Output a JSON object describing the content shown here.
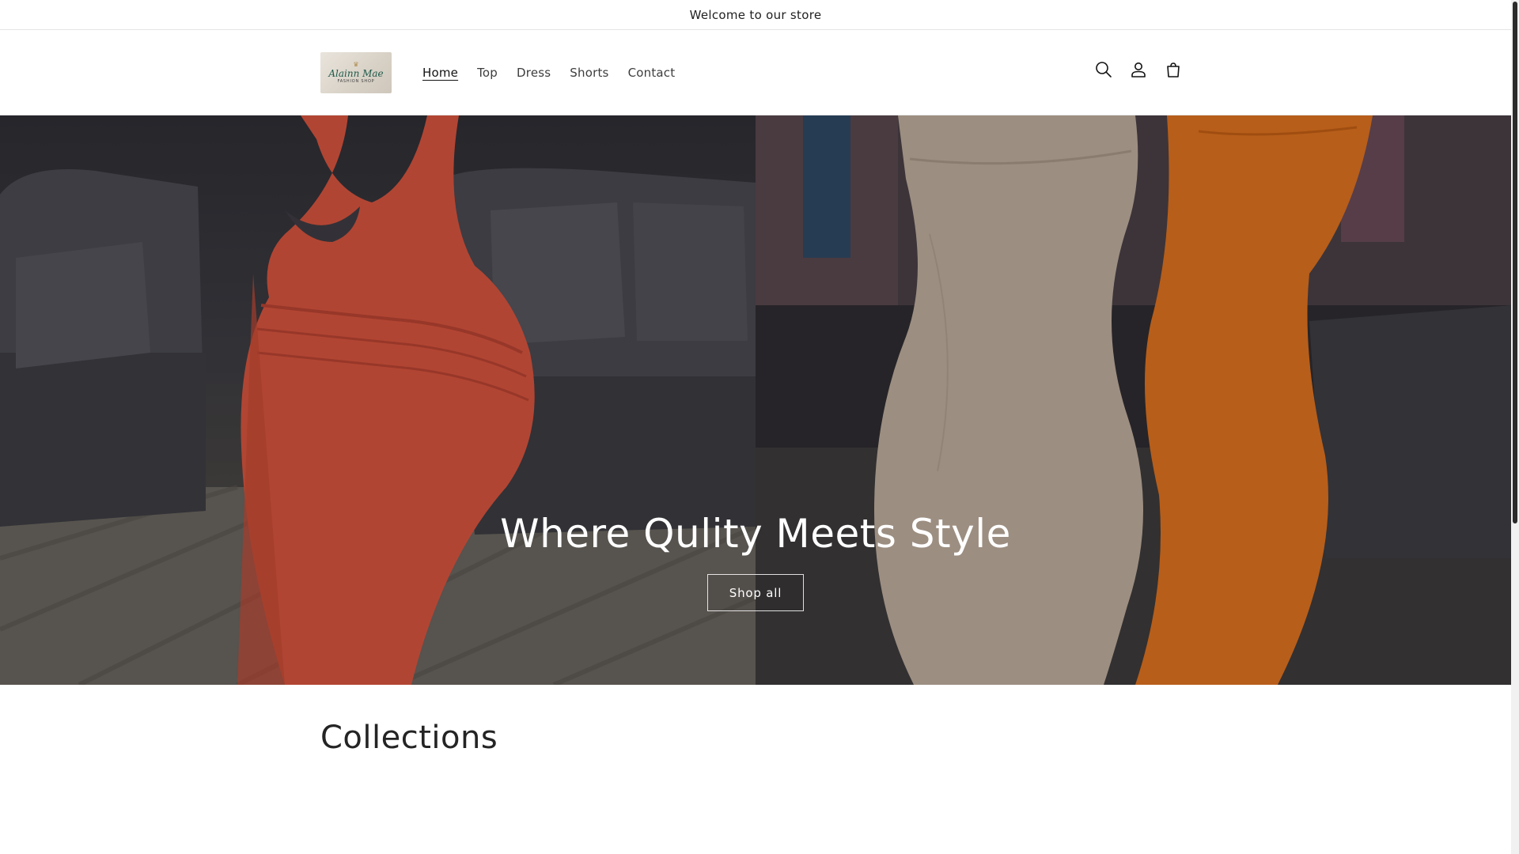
{
  "announcement": {
    "text": "Welcome to our store"
  },
  "header": {
    "logo": {
      "script": "Alainn Mae",
      "sub": "FASHION SHOP",
      "crown": "♛"
    },
    "nav": [
      {
        "label": "Home",
        "active": true
      },
      {
        "label": "Top",
        "active": false
      },
      {
        "label": "Dress",
        "active": false
      },
      {
        "label": "Shorts",
        "active": false
      },
      {
        "label": "Contact",
        "active": false
      }
    ],
    "icons": [
      "search-icon",
      "account-icon",
      "cart-icon"
    ]
  },
  "hero": {
    "title": "Where Qulity Meets Style",
    "button_label": "Shop all",
    "colors": {
      "dress_red": "#d8553f",
      "dress_beige": "#bfae9e",
      "dress_orange": "#e07320",
      "sofa": "#4a4a50"
    }
  },
  "collections": {
    "title": "Collections"
  }
}
